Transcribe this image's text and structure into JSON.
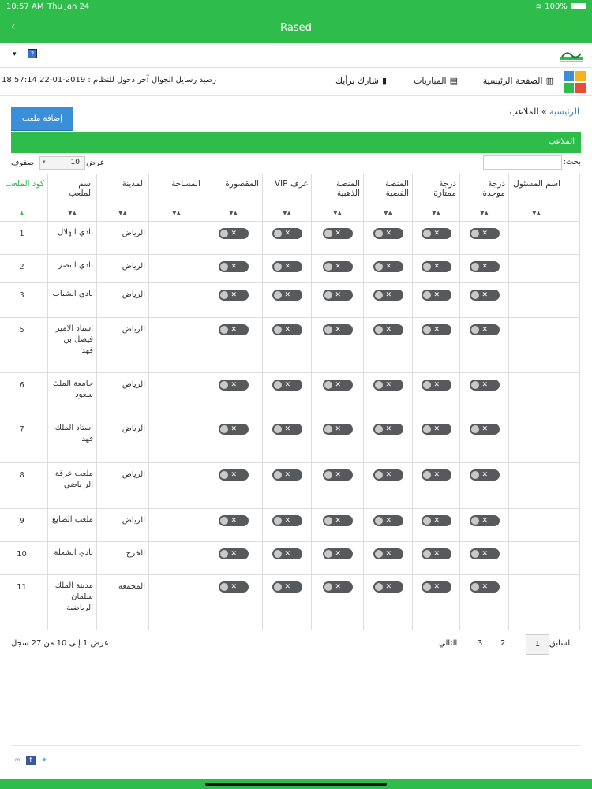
{
  "status": {
    "time": "10:57 AM",
    "date": "Thu Jan 24",
    "battery": "100%"
  },
  "app": {
    "title": "Rased",
    "back": "‹"
  },
  "toolbar": {
    "help_icon": "?",
    "dropdown": "▾"
  },
  "nav": {
    "home": "الصفحة الرئيسية",
    "matches": "المباريات",
    "feedback": "شارك برأيك",
    "balance": "رصيد رسايل الجوال : -",
    "last_login": "آخر دخول للنظام : 2019-01-22 18:57:14"
  },
  "breadcrumb": {
    "home": "الرئيسية",
    "sep": "»",
    "current": "الملاعب"
  },
  "add_button": "إضافة ملعب",
  "panel_title": "الملاعب",
  "search": {
    "label": "بحث:",
    "value": ""
  },
  "length": {
    "show": "عرض",
    "value": "10",
    "rows": "صفوف"
  },
  "columns": [
    {
      "key": "code",
      "label": "كود الملعب"
    },
    {
      "key": "name",
      "label": "اسم الملعب"
    },
    {
      "key": "city",
      "label": "المدينة"
    },
    {
      "key": "area",
      "label": "المساحة"
    },
    {
      "key": "box",
      "label": "المقصورة"
    },
    {
      "key": "vip",
      "label": "غرف VIP"
    },
    {
      "key": "gold",
      "label": "المنصة الذهبية"
    },
    {
      "key": "silver",
      "label": "المنصة الفضية"
    },
    {
      "key": "excellent",
      "label": "درجة ممتازة"
    },
    {
      "key": "unified",
      "label": "درجة موحدة"
    },
    {
      "key": "manager",
      "label": "اسم المسئول"
    }
  ],
  "rows": [
    {
      "code": "1",
      "name": "نادي الهلال",
      "city": "الرياض"
    },
    {
      "code": "2",
      "name": "نادي النصر",
      "city": "الرياض"
    },
    {
      "code": "3",
      "name": "نادي الشباب",
      "city": "الرياض"
    },
    {
      "code": "5",
      "name": "استاد الامير فيصل بن فهد",
      "city": "الرياض"
    },
    {
      "code": "6",
      "name": "جامعة الملك سعود",
      "city": "الرياض"
    },
    {
      "code": "7",
      "name": "استاد الملك فهد",
      "city": "الرياض"
    },
    {
      "code": "8",
      "name": "ملعب عرقة الر ياضي",
      "city": "الرياض"
    },
    {
      "code": "9",
      "name": "ملعب الصايغ",
      "city": "الرياض"
    },
    {
      "code": "10",
      "name": "نادي الشعلة",
      "city": "الخرج"
    },
    {
      "code": "11",
      "name": "مدينة الملك سلمان الرياضية",
      "city": "المجمعة"
    }
  ],
  "pagination": {
    "prev": "السابق",
    "pages": [
      "1",
      "2",
      "3"
    ],
    "next": "التالي",
    "info": "عرض 1 إلى 10 من 27 سجل"
  },
  "toggle_mark": "✕",
  "sort_glyph": "▲▼",
  "colors": {
    "brand_green": "#2ebd4a",
    "button_blue": "#3b8fd9",
    "toggle_off": "#58595b"
  }
}
